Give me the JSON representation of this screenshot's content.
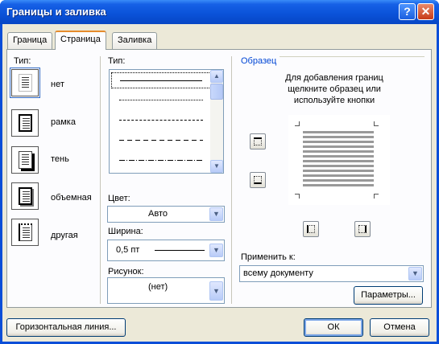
{
  "window": {
    "title": "Границы и заливка"
  },
  "tabs": [
    {
      "label": "Граница"
    },
    {
      "label": "Страница"
    },
    {
      "label": "Заливка"
    }
  ],
  "settings": {
    "label": "Тип:",
    "items": [
      {
        "label": "нет"
      },
      {
        "label": "рамка"
      },
      {
        "label": "тень"
      },
      {
        "label": "объемная"
      },
      {
        "label": "другая"
      }
    ]
  },
  "style": {
    "label": "Тип:",
    "options": [
      "solid",
      "dotted",
      "dashed-small",
      "dashed",
      "dash-dot"
    ]
  },
  "color": {
    "label": "Цвет:",
    "value": "Авто"
  },
  "width": {
    "label": "Ширина:",
    "value": "0,5 пт"
  },
  "art": {
    "label": "Рисунок:",
    "value": "(нет)"
  },
  "preview": {
    "group_label": "Образец",
    "hint": "Для добавления границ щелкните образец или используйте кнопки"
  },
  "apply_to": {
    "label": "Применить к:",
    "value": "всему документу"
  },
  "buttons": {
    "options": "Параметры...",
    "horizontal_line": "Горизонтальная линия...",
    "ok": "ОК",
    "cancel": "Отмена"
  },
  "colors": {
    "title_bar": "#0a52d8",
    "dialog_bg": "#ece9d8",
    "accent": "#e68b2c"
  }
}
